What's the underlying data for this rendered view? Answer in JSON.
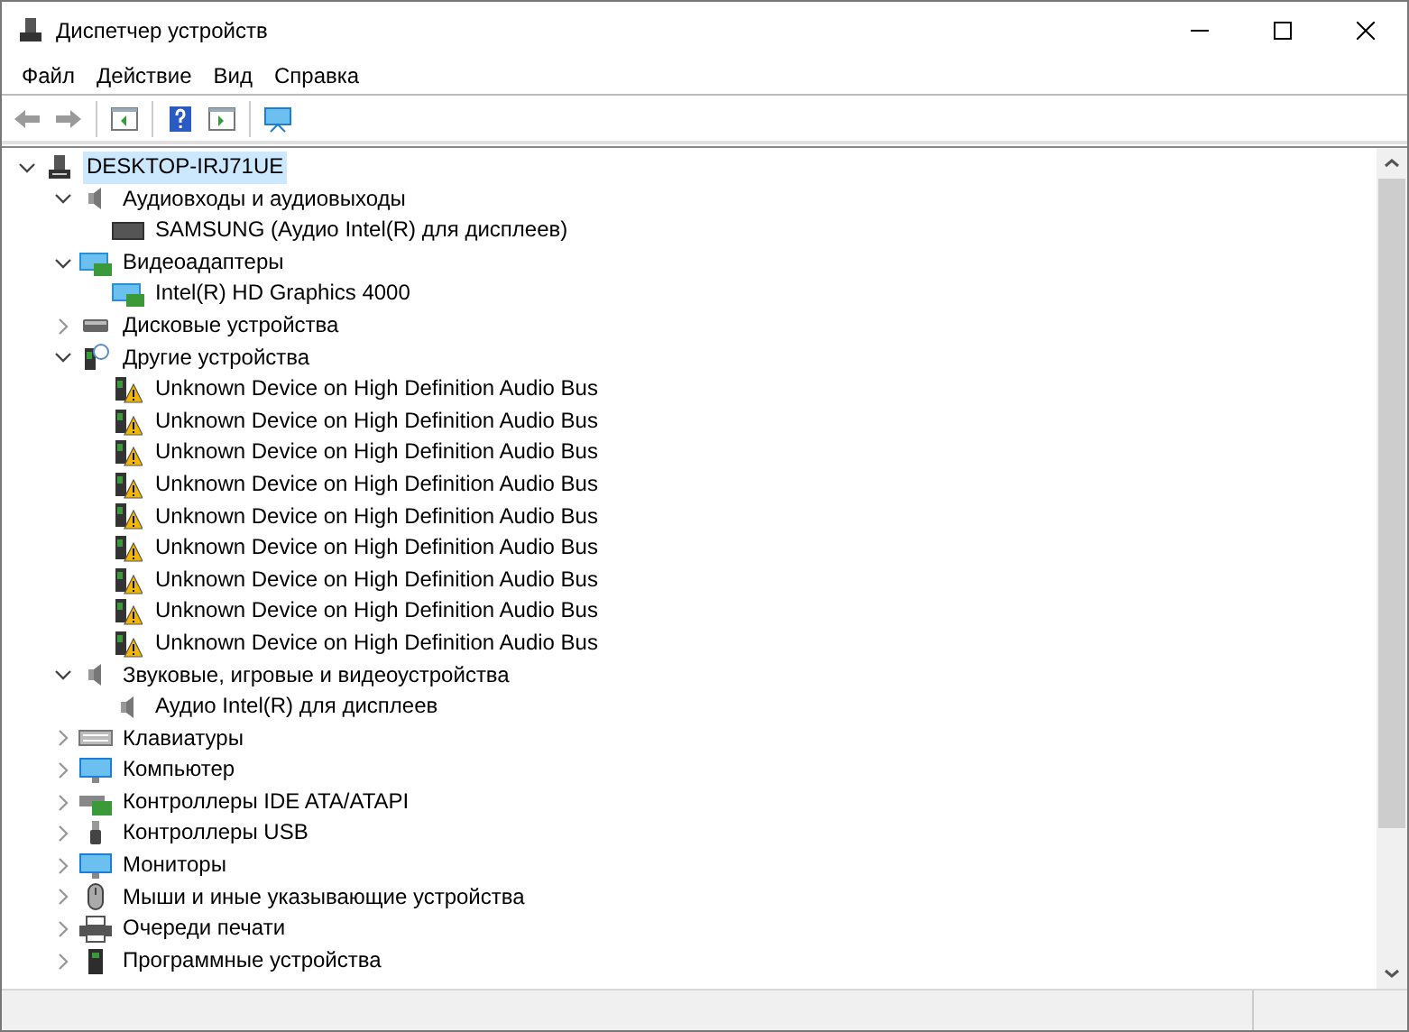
{
  "window": {
    "title": "Диспетчер устройств"
  },
  "menu": [
    "Файл",
    "Действие",
    "Вид",
    "Справка"
  ],
  "tree": [
    {
      "label": "DESKTOP-IRJ71UE",
      "kind": "computer",
      "expanded": true,
      "selected": true,
      "children": [
        {
          "label": "Аудиовходы и аудиовыходы",
          "kind": "speaker",
          "expanded": true,
          "selected": false,
          "children": [
            {
              "label": "SAMSUNG (Аудио Intel(R) для дисплеев)",
              "kind": "tv",
              "selected": false
            }
          ]
        },
        {
          "label": "Видеоадаптеры",
          "kind": "video",
          "expanded": true,
          "selected": false,
          "children": [
            {
              "label": "Intel(R) HD Graphics 4000",
              "kind": "video",
              "selected": false
            }
          ]
        },
        {
          "label": "Дисковые устройства",
          "kind": "disk",
          "expanded": false,
          "selected": false
        },
        {
          "label": "Другие устройства",
          "kind": "unknown",
          "expanded": true,
          "selected": false,
          "children": [
            {
              "label": "Unknown Device on High Definition Audio Bus",
              "kind": "warning",
              "selected": false
            },
            {
              "label": "Unknown Device on High Definition Audio Bus",
              "kind": "warning",
              "selected": false
            },
            {
              "label": "Unknown Device on High Definition Audio Bus",
              "kind": "warning",
              "selected": false
            },
            {
              "label": "Unknown Device on High Definition Audio Bus",
              "kind": "warning",
              "selected": false
            },
            {
              "label": "Unknown Device on High Definition Audio Bus",
              "kind": "warning",
              "selected": false
            },
            {
              "label": "Unknown Device on High Definition Audio Bus",
              "kind": "warning",
              "selected": false
            },
            {
              "label": "Unknown Device on High Definition Audio Bus",
              "kind": "warning",
              "selected": false
            },
            {
              "label": "Unknown Device on High Definition Audio Bus",
              "kind": "warning",
              "selected": false
            },
            {
              "label": "Unknown Device on High Definition Audio Bus",
              "kind": "warning",
              "selected": false
            }
          ]
        },
        {
          "label": "Звуковые, игровые и видеоустройства",
          "kind": "speaker",
          "expanded": true,
          "selected": false,
          "children": [
            {
              "label": "Аудио Intel(R) для дисплеев",
              "kind": "speaker",
              "selected": false
            }
          ]
        },
        {
          "label": "Клавиатуры",
          "kind": "keyboard",
          "expanded": false,
          "selected": false
        },
        {
          "label": "Компьютер",
          "kind": "monitor",
          "expanded": false,
          "selected": false
        },
        {
          "label": "Контроллеры IDE ATA/ATAPI",
          "kind": "ide",
          "expanded": false,
          "selected": false
        },
        {
          "label": "Контроллеры USB",
          "kind": "usb",
          "expanded": false,
          "selected": false
        },
        {
          "label": "Мониторы",
          "kind": "monitor",
          "expanded": false,
          "selected": false
        },
        {
          "label": "Мыши и иные указывающие устройства",
          "kind": "mouse",
          "expanded": false,
          "selected": false
        },
        {
          "label": "Очереди печати",
          "kind": "printer",
          "expanded": false,
          "selected": false
        },
        {
          "label": "Программные устройства",
          "kind": "firmware",
          "expanded": false,
          "selected": false
        }
      ]
    }
  ]
}
